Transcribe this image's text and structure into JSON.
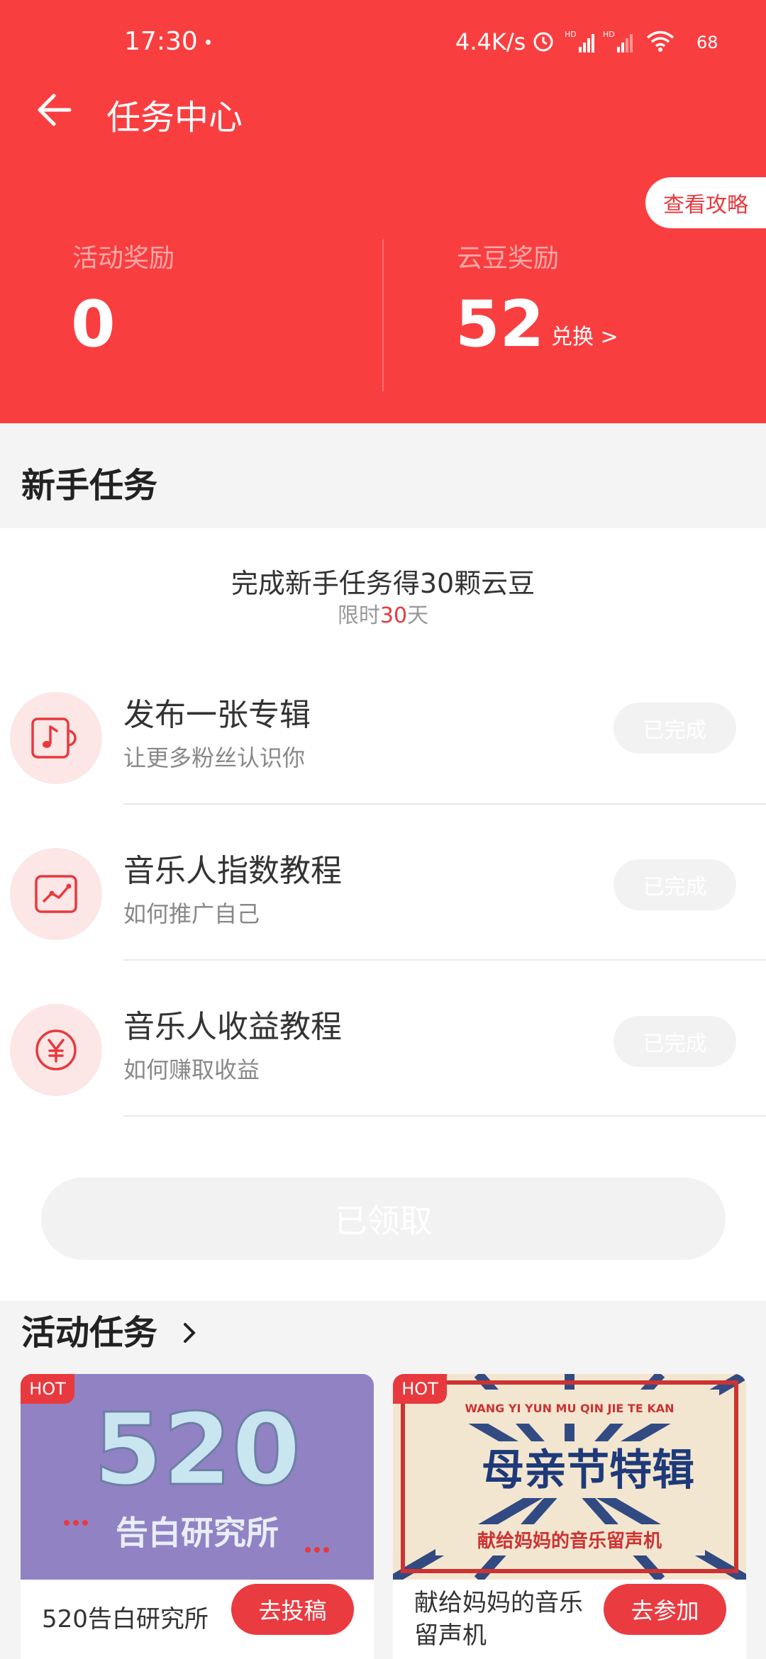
{
  "status_bar": {
    "time": "17:30",
    "speed": "4.4K/s",
    "battery": "68"
  },
  "header": {
    "title": "任务中心",
    "guide_label": "查看攻略",
    "activity_reward_label": "活动奖励",
    "activity_reward_value": "0",
    "bean_reward_label": "云豆奖励",
    "bean_reward_value": "52",
    "exchange_label": "兑换 >"
  },
  "newbie": {
    "section_title": "新手任务",
    "promo_title": "完成新手任务得30颗云豆",
    "promo_sub_prefix": "限时",
    "promo_sub_days": "30",
    "promo_sub_suffix": "天",
    "tasks": [
      {
        "title": "发布一张专辑",
        "desc": "让更多粉丝认识你",
        "status": "已完成",
        "icon": "music-note-icon"
      },
      {
        "title": "音乐人指数教程",
        "desc": "如何推广自己",
        "status": "已完成",
        "icon": "chart-icon"
      },
      {
        "title": "音乐人收益教程",
        "desc": "如何赚取收益",
        "status": "已完成",
        "icon": "yen-icon"
      }
    ],
    "claim_label": "已领取"
  },
  "activities": {
    "section_title": "活动任务",
    "cards": [
      {
        "hot": "HOT",
        "name": "520告白研究所",
        "button": "去投稿",
        "banner_big": "520",
        "banner_text": "告白研究所"
      },
      {
        "hot": "HOT",
        "name": "献给妈妈的音乐留声机",
        "button": "去参加",
        "banner_top": "WANG YI YUN MU QIN JIE TE KAN",
        "banner_big": "母亲节特辑",
        "banner_sub": "献给妈妈的音乐留声机"
      }
    ]
  },
  "colors": {
    "brand_red": "#f93e40",
    "button_red": "#ea3b40",
    "icon_bg": "#fde6e6",
    "disabled_button": "#f2f2f2"
  }
}
